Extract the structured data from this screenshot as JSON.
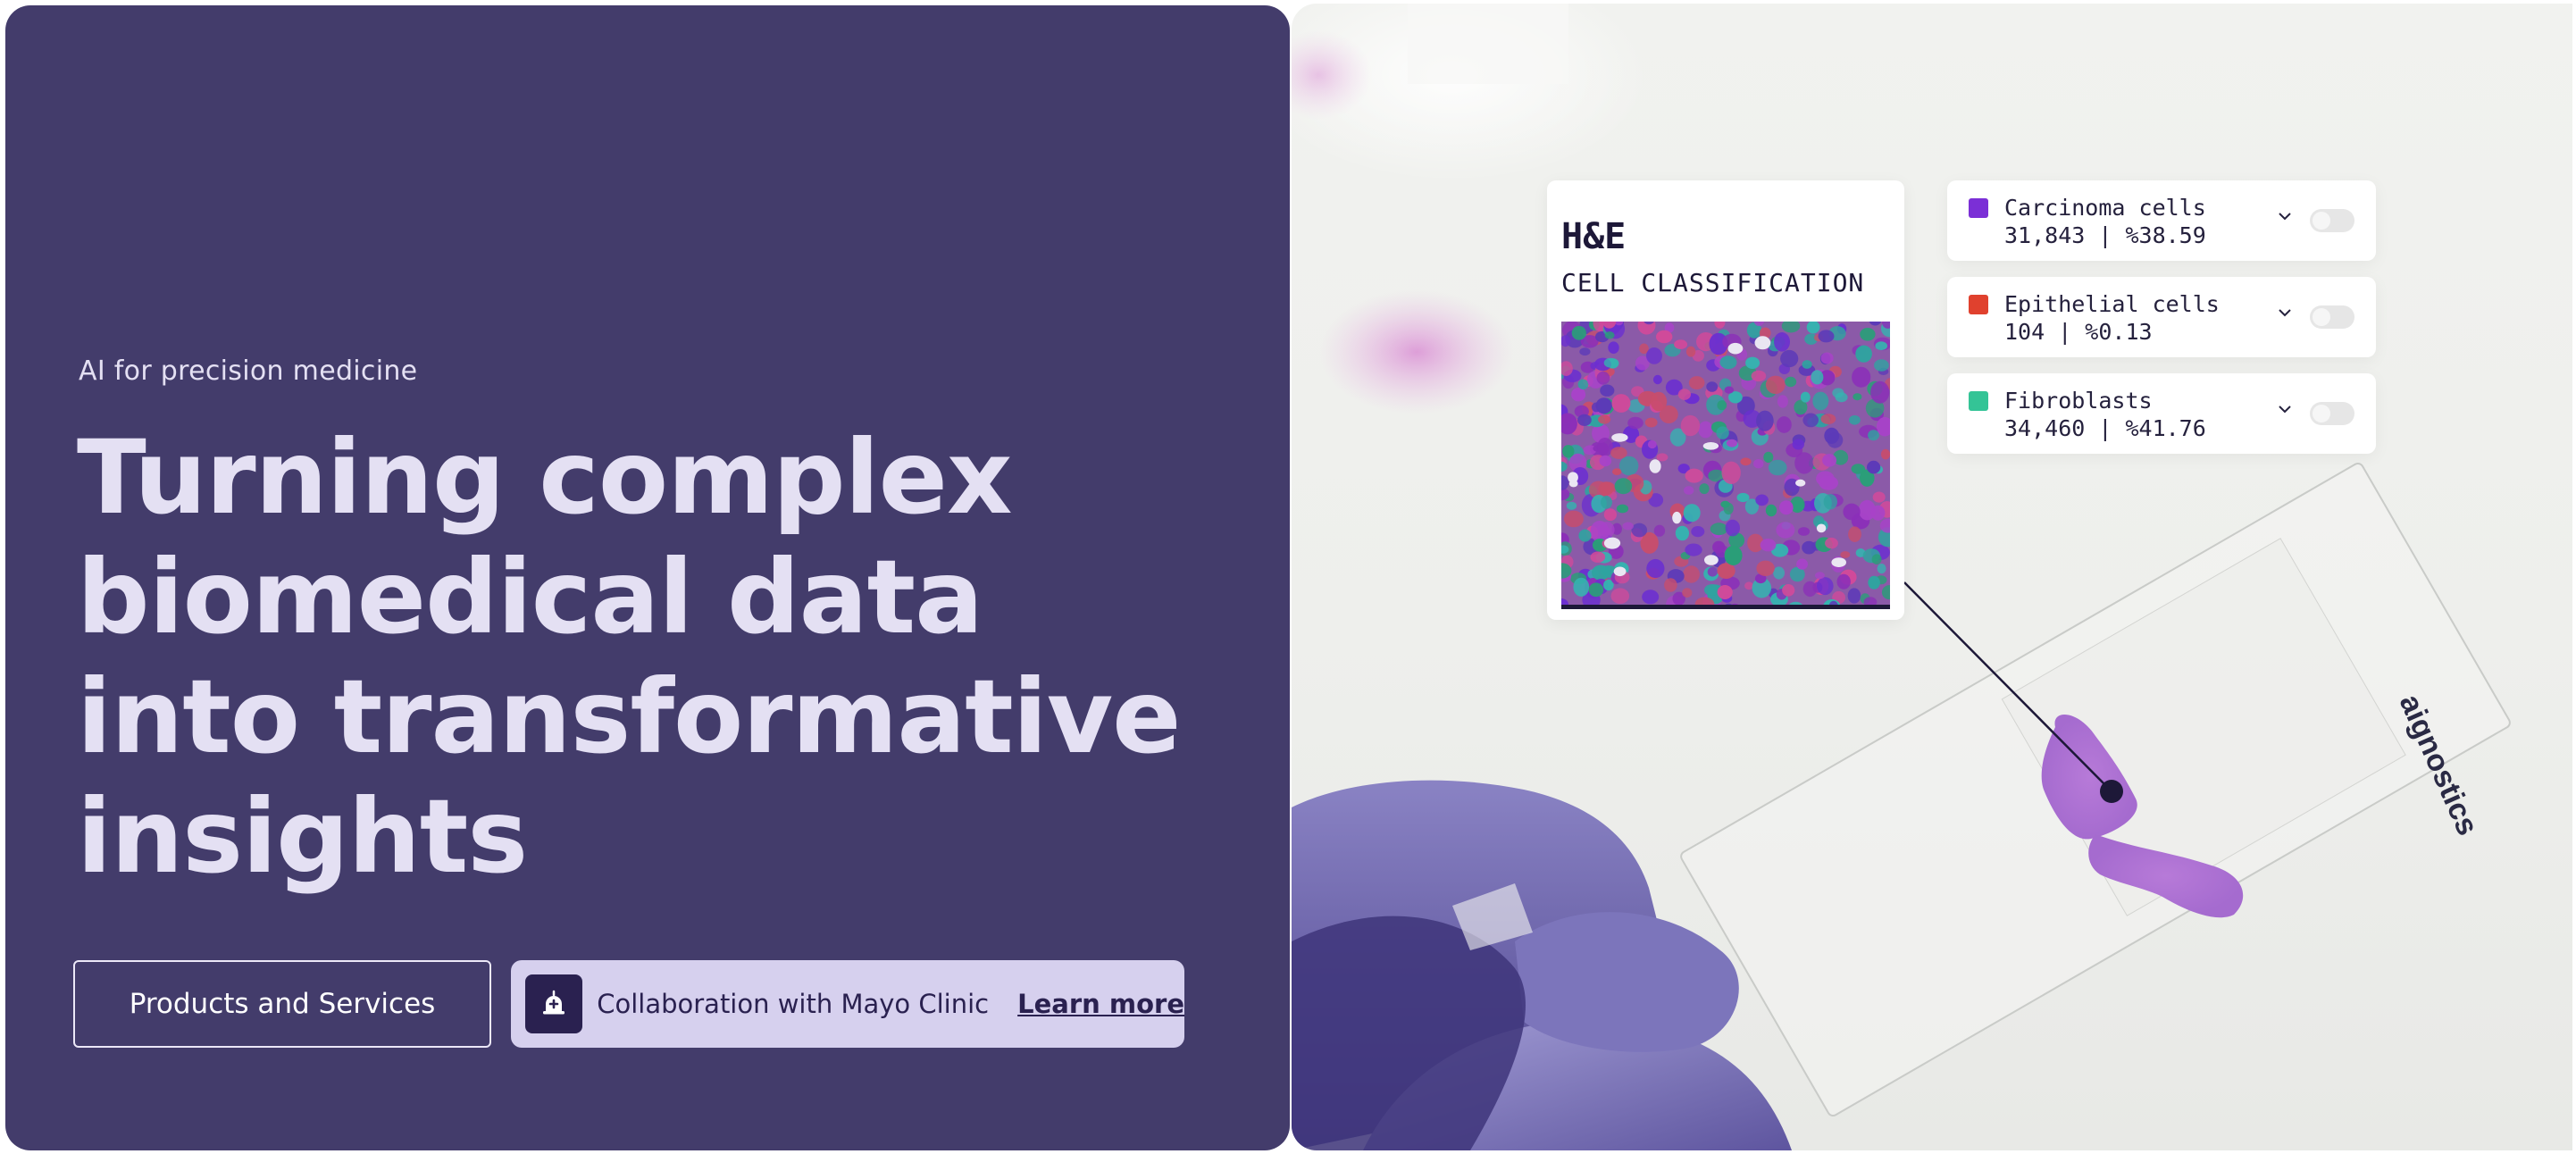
{
  "hero": {
    "eyebrow": "AI for precision medicine",
    "headline_lines": [
      "Turning complex",
      "biomedical data",
      "into transformative",
      "insights"
    ],
    "products_button": "Products and Services",
    "collab_text": "Collaboration with Mayo Clinic",
    "collab_link": "Learn more",
    "collab_icon": "hospital-bell-icon"
  },
  "panel": {
    "title": "H&E",
    "subtitle": "CELL CLASSIFICATION"
  },
  "legend": [
    {
      "name": "Carcinoma cells",
      "count": "31,843 | %38.59",
      "color": "#7b2fd6",
      "enabled": false
    },
    {
      "name": "Epithelial cells",
      "count": "104 | %0.13",
      "color": "#e0412e",
      "enabled": false
    },
    {
      "name": "Fibroblasts",
      "count": "34,460 | %41.76",
      "color": "#34c496",
      "enabled": false
    }
  ],
  "slide_brand": "aignostics",
  "colors": {
    "hero_bg": "#433c6b",
    "hero_text": "#e4e0f3",
    "collab_bg": "#d6d0ee",
    "dark_navy": "#1d1838"
  }
}
